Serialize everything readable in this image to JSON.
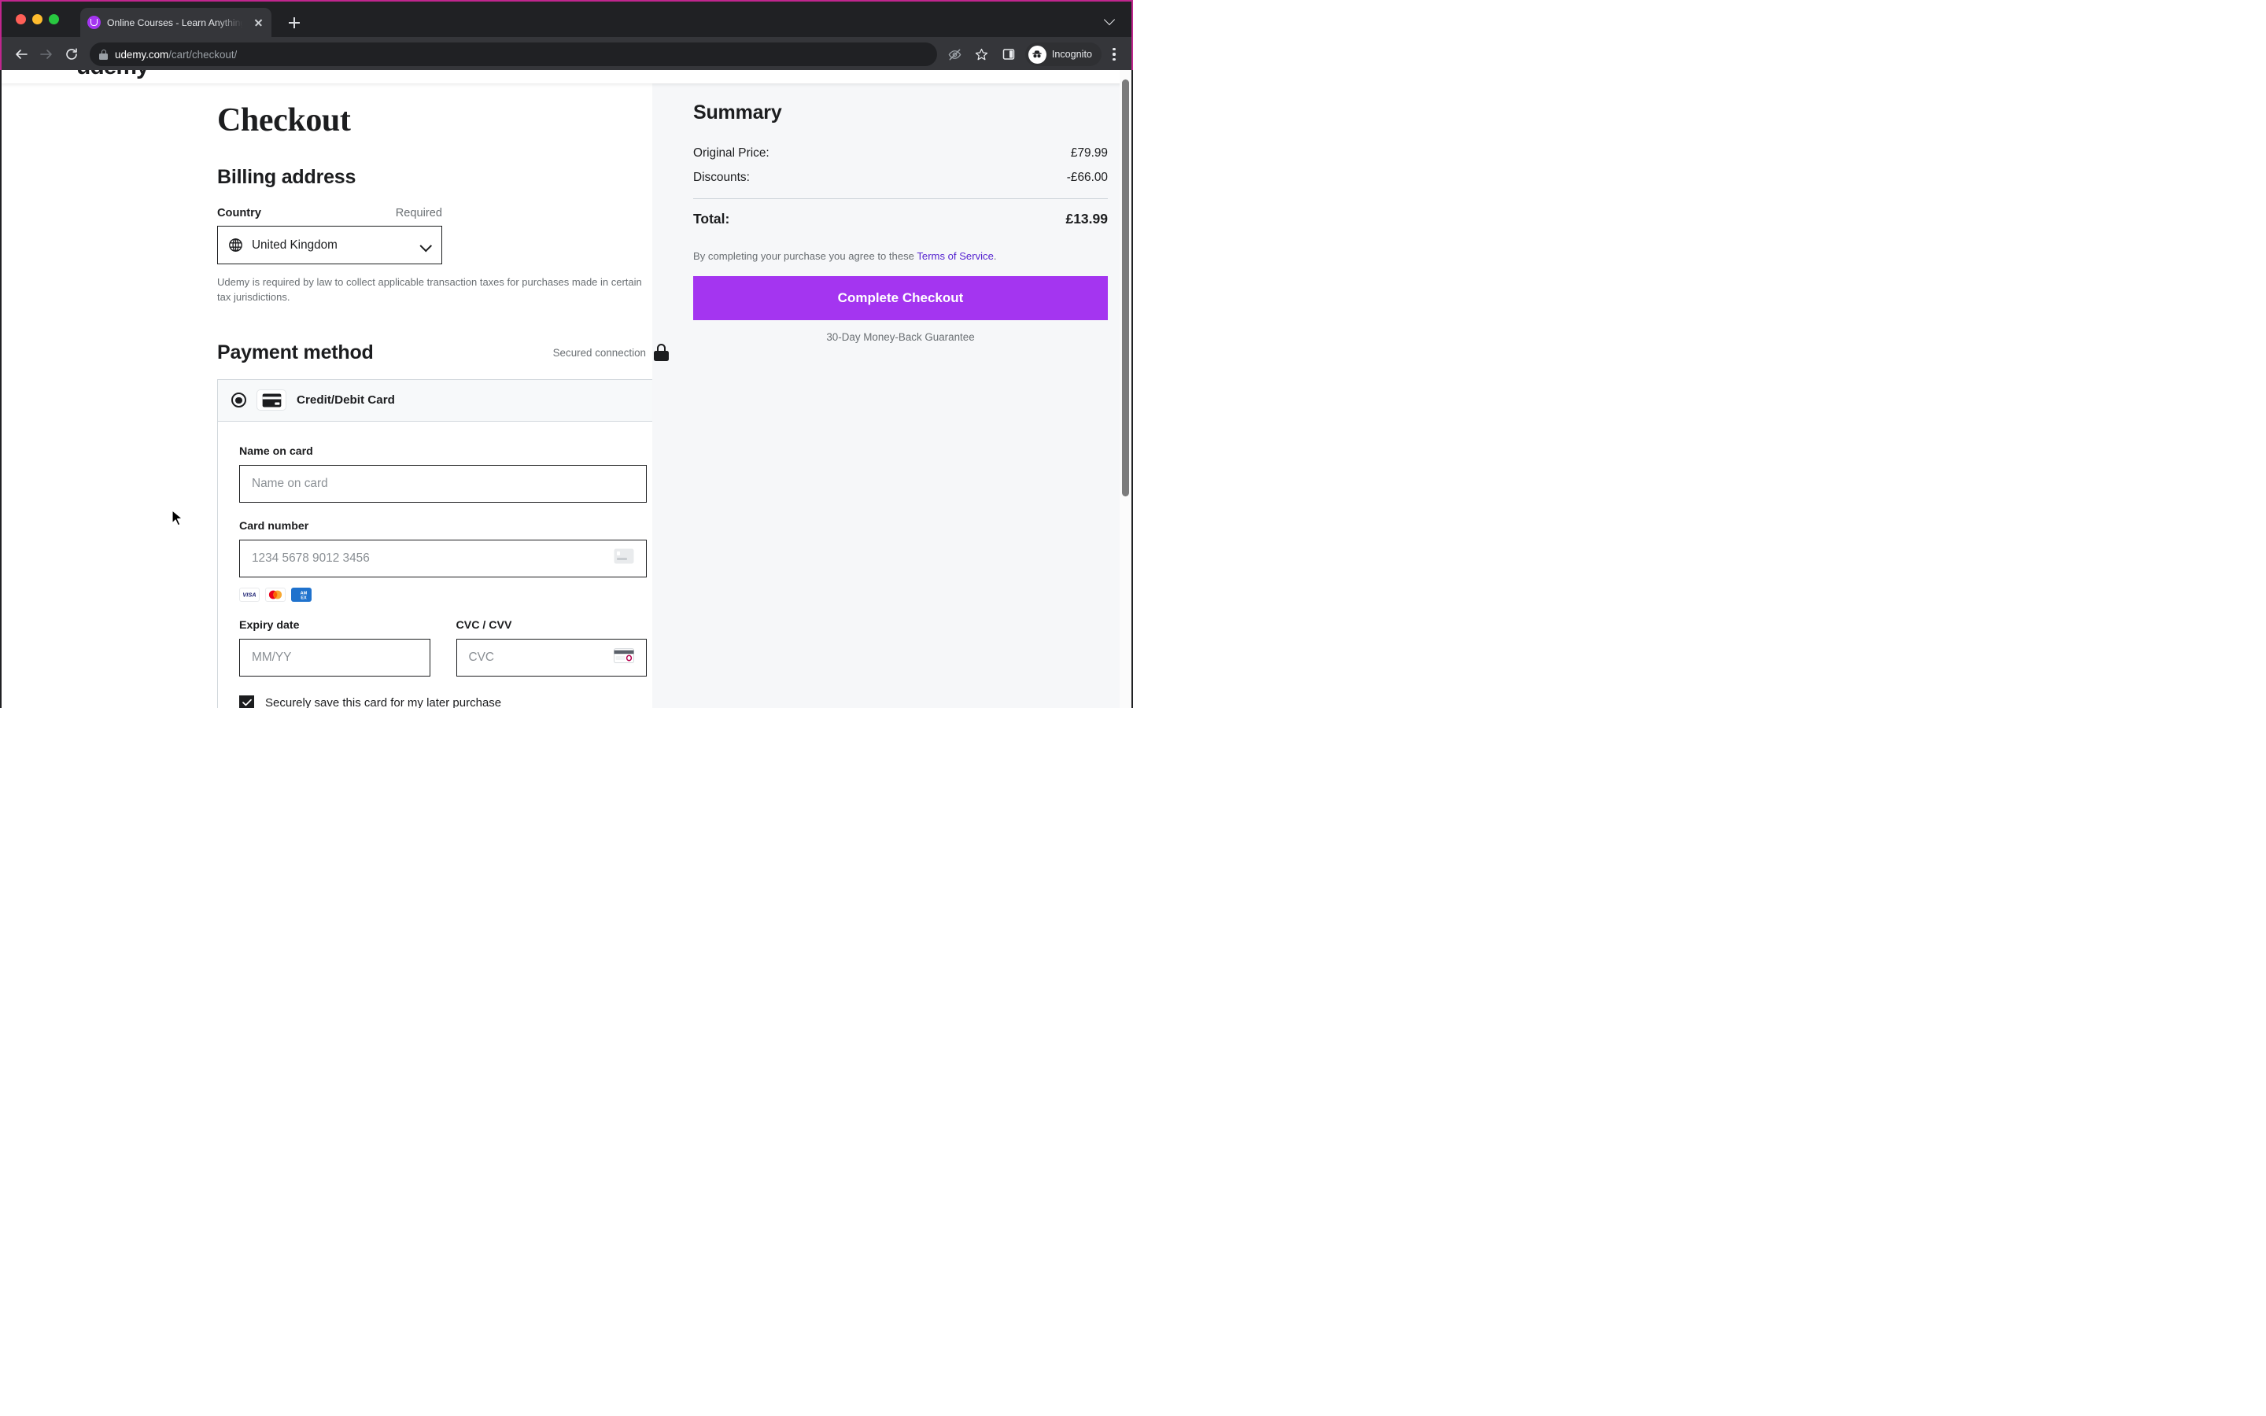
{
  "browser": {
    "tab": {
      "title": "Online Courses - Learn Anything",
      "favicon": "udemy-logo-icon",
      "close_label": "×"
    },
    "new_tab_label": "+",
    "tab_list_label": "v",
    "back_label": "Back",
    "forward_label": "Forward",
    "reload_label": "Reload",
    "url_host": "udemy.com",
    "url_path": "/cart/checkout/",
    "lock_icon": "lock-icon",
    "icons": {
      "no_tracking": "eye-slash-icon",
      "bookmark": "star-icon",
      "side_panel": "side-panel-icon",
      "menu": "kebab-menu-icon"
    },
    "profile_label": "Incognito"
  },
  "site": {
    "logo_text": "udemy"
  },
  "page": {
    "title": "Checkout"
  },
  "billing": {
    "section_title": "Billing address",
    "country_label": "Country",
    "country_required": "Required",
    "country_value": "United Kingdom",
    "globe_icon": "globe-icon",
    "chevron_icon": "chevron-down-icon",
    "tax_note": "Udemy is required by law to collect applicable transaction taxes for purchases made in certain tax jurisdictions."
  },
  "payment": {
    "section_title": "Payment method",
    "secured_text": "Secured connection",
    "secured_icon": "lock-icon",
    "option_label": "Credit/Debit Card",
    "option_icon": "credit-card-icon",
    "radio_selected": true,
    "name_label": "Name on card",
    "name_placeholder": "Name on card",
    "name_value": "",
    "card_label": "Card number",
    "card_placeholder": "1234 5678 9012 3456",
    "card_value": "",
    "card_input_icon": "credit-card-icon",
    "brands": [
      "VISA",
      "Mastercard",
      "AMEX"
    ],
    "brand_labels": {
      "visa": "VISA",
      "amex_line1": "AM",
      "amex_line2": "EX"
    },
    "expiry_label": "Expiry date",
    "expiry_placeholder": "MM/YY",
    "expiry_value": "",
    "cvc_label": "CVC / CVV",
    "cvc_placeholder": "CVC",
    "cvc_value": "",
    "cvc_icon": "card-back-cvc-icon",
    "save_card_label": "Securely save this card for my later purchase",
    "save_card_checked": true,
    "check_icon": "check-icon"
  },
  "summary": {
    "title": "Summary",
    "rows": [
      {
        "label": "Original Price:",
        "value": "£79.99"
      },
      {
        "label": "Discounts:",
        "value": "-£66.00"
      }
    ],
    "total_label": "Total:",
    "total_value": "£13.99",
    "terms_prefix": "By completing your purchase you agree to these ",
    "terms_link": "Terms of Service",
    "terms_suffix": ".",
    "cta_label": "Complete Checkout",
    "guarantee": "30-Day Money-Back Guarantee",
    "accent_color": "#a435f0",
    "link_color": "#5624d0"
  }
}
